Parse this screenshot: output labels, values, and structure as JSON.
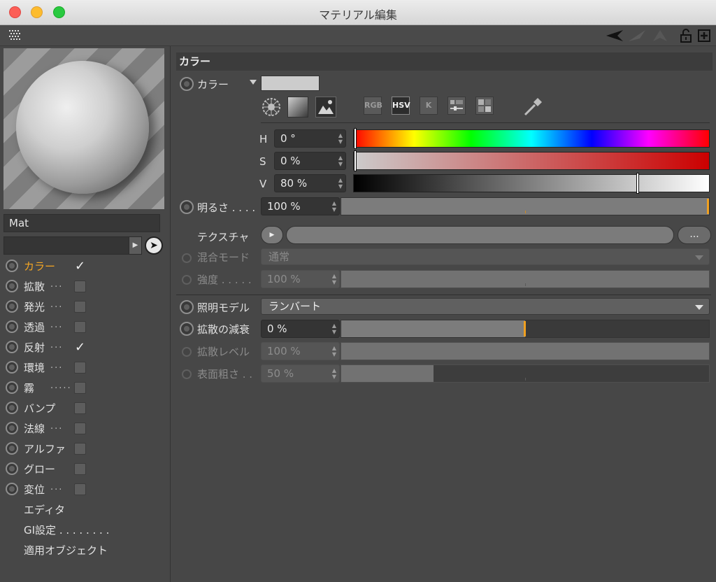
{
  "window": {
    "title": "マテリアル編集"
  },
  "toolbar": {
    "grid_icon": "grid-icon",
    "back_icon": "arrow-left-icon",
    "lock_icon": "lock-icon",
    "add_icon": "plus-box-icon"
  },
  "preview": {
    "material_name": "Mat"
  },
  "channels": [
    {
      "label": "カラー",
      "dots": "",
      "checked": true,
      "active": true
    },
    {
      "label": "拡散",
      "dots": "...",
      "checked": false
    },
    {
      "label": "発光",
      "dots": "...",
      "checked": false
    },
    {
      "label": "透過",
      "dots": "...",
      "checked": false
    },
    {
      "label": "反射",
      "dots": "...",
      "checked": true
    },
    {
      "label": "環境",
      "dots": "...",
      "checked": false
    },
    {
      "label": "霧",
      "dots": ".....",
      "checked": false
    },
    {
      "label": "バンプ",
      "dots": "",
      "checked": false
    },
    {
      "label": "法線",
      "dots": "...",
      "checked": false
    },
    {
      "label": "アルファ",
      "dots": "",
      "checked": false
    },
    {
      "label": "グロー",
      "dots": "",
      "checked": false
    },
    {
      "label": "変位",
      "dots": "...",
      "checked": false
    }
  ],
  "extra_items": [
    "エディタ",
    "GI設定 . . . . . . . .",
    "適用オブジェクト"
  ],
  "section": {
    "title": "カラー"
  },
  "color": {
    "label": "カラー",
    "swatch": "#cccccc",
    "mode_buttons": [
      "RGB",
      "HSV",
      "K"
    ],
    "active_mode": "HSV",
    "h_label": "H",
    "h_value": "0 °",
    "h_fraction": 0.0,
    "s_label": "S",
    "s_value": "0 %",
    "s_fraction": 0.0,
    "v_label": "V",
    "v_value": "80 %",
    "v_fraction": 0.8
  },
  "brightness": {
    "label": "明るさ . . . .",
    "value": "100 %",
    "fraction": 1.0
  },
  "texture": {
    "label": "テクスチャ",
    "more_label": "..."
  },
  "blend": {
    "label": "混合モード",
    "value": "通常"
  },
  "strength": {
    "label": "強度 . . . . .",
    "value": "100 %",
    "fraction": 1.0
  },
  "lighting": {
    "label": "照明モデル",
    "value": "ランバート"
  },
  "diffuse_falloff": {
    "label": "拡散の減衰",
    "value": "0 %",
    "fraction": 0.5
  },
  "diffuse_level": {
    "label": "拡散レベル",
    "value": "100 %",
    "fraction": 1.0
  },
  "roughness": {
    "label": "表面粗さ . .",
    "value": "50 %",
    "fraction": 0.25
  }
}
